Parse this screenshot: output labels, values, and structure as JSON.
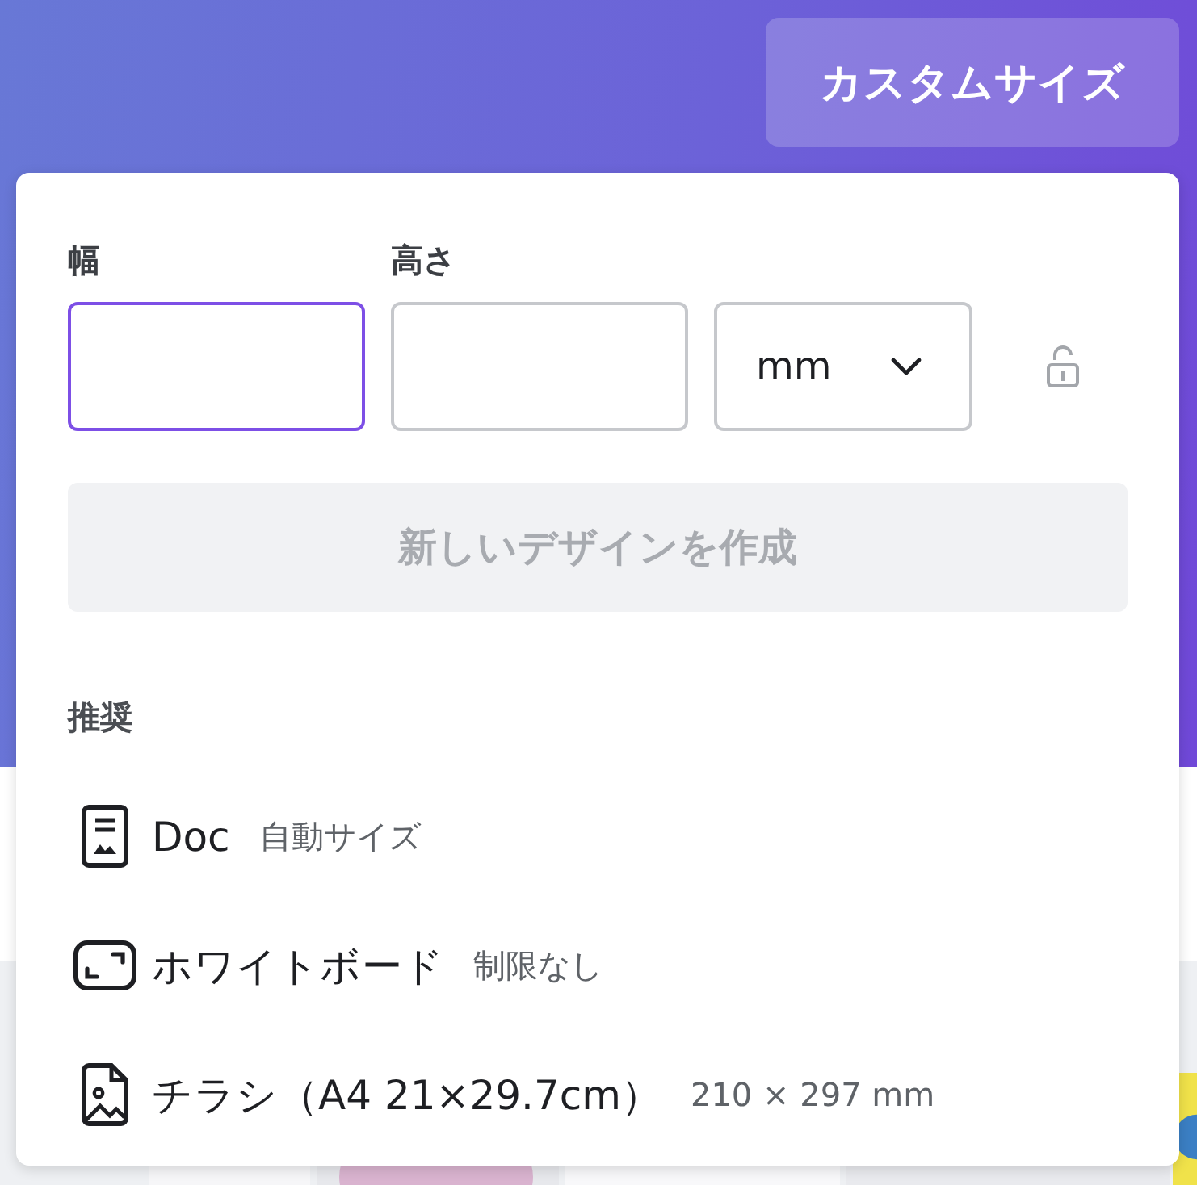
{
  "header_button": {
    "label": "カスタムサイズ"
  },
  "size_form": {
    "fields": [
      {
        "label": "幅",
        "focused": true
      },
      {
        "label": "高さ",
        "focused": false
      }
    ],
    "unit": {
      "value": "mm"
    },
    "lock": {
      "locked": false
    },
    "create_button": {
      "label": "新しいデザインを作成",
      "disabled": true
    }
  },
  "recommended": {
    "heading": "推奨",
    "items": [
      {
        "kind": "doc",
        "name": "Doc",
        "detail": "自動サイズ"
      },
      {
        "kind": "whiteboard",
        "name": "ホワイトボード",
        "detail": "制限なし"
      },
      {
        "kind": "flyer",
        "name": "チラシ（A4 21×29.7cm）",
        "detail": "210 × 297 mm"
      }
    ]
  }
}
